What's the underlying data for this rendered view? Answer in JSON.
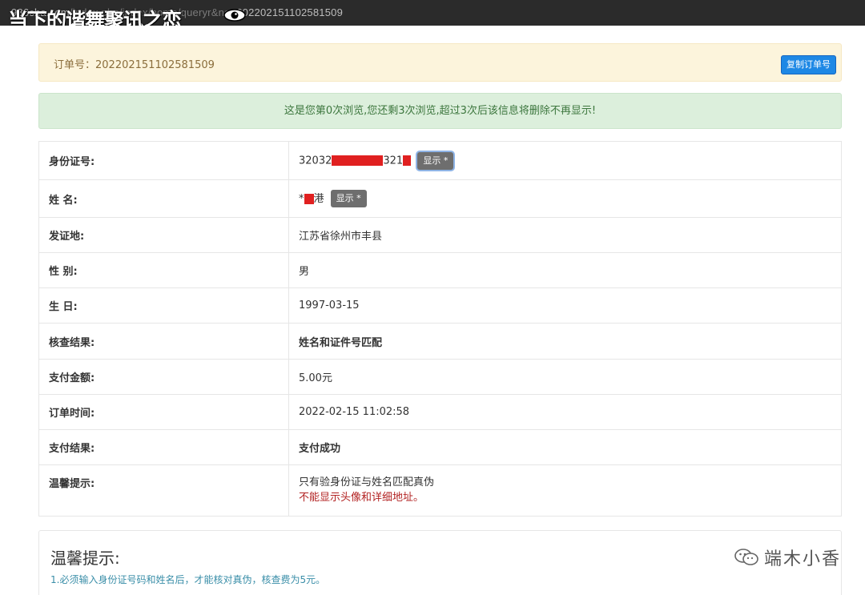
{
  "browser": {
    "url_main": "986cha.com",
    "url_path": "/index.php/index/home/queryr&no=",
    "url_tail": "202202151102581509",
    "overlay_text": "当下的谐舞聚讯之恋"
  },
  "order": {
    "label": "订单号：202202151102581509",
    "copy_button": "复制订单号"
  },
  "notice": "这是您第0次浏览,您还剩3次浏览,超过3次后该信息将删除不再显示!",
  "rows": {
    "id": {
      "label": "身份证号:",
      "prefix": "32032",
      "suffix": "321",
      "show": "显示 *"
    },
    "name": {
      "label": "姓 名:",
      "prefix": "*",
      "suffix": "港",
      "show": "显示 *"
    },
    "place": {
      "label": "发证地:",
      "value": "江苏省徐州市丰县"
    },
    "gender": {
      "label": "性 别:",
      "value": "男"
    },
    "birthday": {
      "label": "生 日:",
      "value": "1997-03-15"
    },
    "result": {
      "label": "核查结果:",
      "value": "姓名和证件号匹配"
    },
    "amount": {
      "label": "支付金额:",
      "value": "5.00元"
    },
    "time": {
      "label": "订单时间:",
      "value": "2022-02-15 11:02:58"
    },
    "pay": {
      "label": "支付结果:",
      "value": "支付成功"
    },
    "tip": {
      "label": "温馨提示:",
      "line1": "只有验身份证与姓名匹配真伪",
      "line2": "不能显示头像和详细地址。"
    }
  },
  "tips": {
    "title": "温馨提示:",
    "line": "1.必须输入身份证号码和姓名后，才能核对真伪，核查费为5元。"
  },
  "watermark": {
    "icon": "wechat-icon",
    "text": "端木小香"
  },
  "colors": {
    "redaction": "#e02020",
    "success_green": "#3d8b3d",
    "warning_red": "#b22222",
    "copy_button_blue": "#1e88e5"
  }
}
